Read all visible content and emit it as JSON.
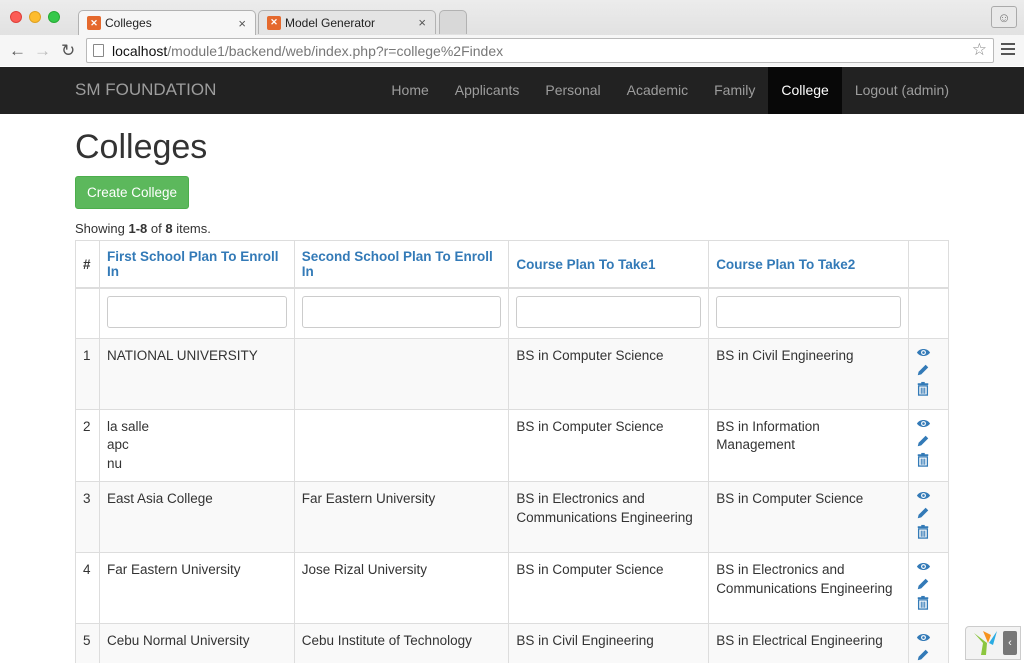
{
  "browser": {
    "tabs": [
      {
        "title": "Colleges",
        "active": true
      },
      {
        "title": "Model Generator",
        "active": false
      }
    ],
    "url_host": "localhost",
    "url_path": "/module1/backend/web/index.php?r=college%2Findex"
  },
  "navbar": {
    "brand": "SM FOUNDATION",
    "links": [
      "Home",
      "Applicants",
      "Personal",
      "Academic",
      "Family",
      "College",
      "Logout (admin)"
    ],
    "active": "College"
  },
  "page": {
    "title": "Colleges",
    "create_button": "Create College",
    "summary_prefix": "Showing ",
    "summary_range": "1-8",
    "summary_mid": " of ",
    "summary_total": "8",
    "summary_suffix": " items."
  },
  "table": {
    "columns": [
      "#",
      "First School Plan To Enroll In",
      "Second School Plan To Enroll In",
      "Course Plan To Take1",
      "Course Plan To Take2"
    ],
    "rows": [
      {
        "num": "1",
        "first": [
          "NATIONAL UNIVERSITY"
        ],
        "second": [],
        "course1": [
          "BS in Computer Science"
        ],
        "course2": [
          "BS in Civil Engineering"
        ]
      },
      {
        "num": "2",
        "first": [
          "la salle",
          "apc",
          "nu"
        ],
        "second": [],
        "course1": [
          "BS in Computer Science"
        ],
        "course2": [
          "BS in Information Management"
        ]
      },
      {
        "num": "3",
        "first": [
          "East Asia College"
        ],
        "second": [
          "Far Eastern University"
        ],
        "course1": [
          "BS in Electronics and",
          "Communications Engineering"
        ],
        "course2": [
          "BS in Computer Science"
        ]
      },
      {
        "num": "4",
        "first": [
          "Far Eastern University"
        ],
        "second": [
          "Jose Rizal University"
        ],
        "course1": [
          "BS in Computer Science"
        ],
        "course2": [
          "BS in Electronics and",
          "Communications Engineering"
        ]
      },
      {
        "num": "5",
        "first": [
          "Cebu Normal University"
        ],
        "second": [
          "Cebu Institute of Technology"
        ],
        "course1": [
          "BS in Civil Engineering"
        ],
        "course2": [
          "BS in Electrical Engineering"
        ]
      }
    ]
  },
  "icons": {
    "view": "eye-icon",
    "edit": "pencil-icon",
    "delete": "trash-icon"
  },
  "colors": {
    "link": "#337ab7",
    "success": "#5cb85c",
    "navbar": "#222222"
  }
}
